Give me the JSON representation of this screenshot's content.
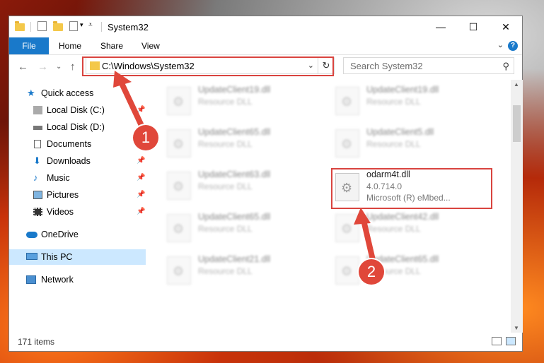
{
  "window": {
    "title": "System32",
    "minimize": "—",
    "maximize": "☐",
    "close": "✕"
  },
  "ribbon": {
    "file": "File",
    "home": "Home",
    "share": "Share",
    "view": "View",
    "help": "?"
  },
  "nav": {
    "address": "C:\\Windows\\System32",
    "search_placeholder": "Search System32"
  },
  "sidebar": {
    "items": [
      {
        "label": "Quick access"
      },
      {
        "label": "Local Disk (C:)"
      },
      {
        "label": "Local Disk (D:)"
      },
      {
        "label": "Documents"
      },
      {
        "label": "Downloads"
      },
      {
        "label": "Music"
      },
      {
        "label": "Pictures"
      },
      {
        "label": "Videos"
      },
      {
        "label": "OneDrive"
      },
      {
        "label": "This PC"
      },
      {
        "label": "Network"
      }
    ]
  },
  "files": [
    {
      "name": "UpdateClient19.dll",
      "type": "Resource DLL"
    },
    {
      "name": "UpdateClient19.dll",
      "type": "Resource DLL"
    },
    {
      "name": "UpdateClient65.dll",
      "type": "Resource DLL"
    },
    {
      "name": "UpdateClient5.dll",
      "type": "Resource DLL"
    },
    {
      "name": "UpdateClient63.dll",
      "type": "Resource DLL"
    },
    {
      "name": "odarm4t.dll",
      "version": "4.0.714.0",
      "company": "Microsoft (R) eMbed..."
    },
    {
      "name": "UpdateClient65.dll",
      "type": "Resource DLL"
    },
    {
      "name": "UpdateClient42.dll",
      "type": "Resource DLL"
    },
    {
      "name": "UpdateClient21.dll",
      "type": "Resource DLL"
    },
    {
      "name": "UpdateClient65.dll",
      "type": "Resource DLL"
    }
  ],
  "status": {
    "items": "171 items"
  },
  "annotations": {
    "step1": "1",
    "step2": "2"
  }
}
